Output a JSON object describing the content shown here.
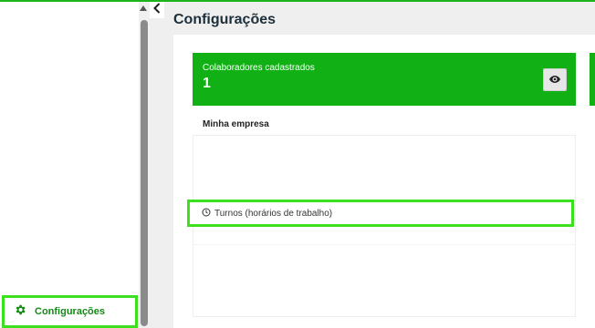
{
  "sidebar": {
    "active_item": {
      "label": "Configurações",
      "icon": "gear-icon"
    }
  },
  "main": {
    "title": "Configurações",
    "stat_card": {
      "title": "Colaboradores cadastrados",
      "value": "1",
      "action_icon": "eye-icon"
    },
    "section_title": "Minha empresa",
    "items": [
      {
        "label": "Turnos (horários de trabalho)",
        "icon": "clock-icon"
      }
    ]
  },
  "colors": {
    "accent": "#11b116",
    "highlight": "#3be01f",
    "title_text": "#1d2f3b"
  }
}
